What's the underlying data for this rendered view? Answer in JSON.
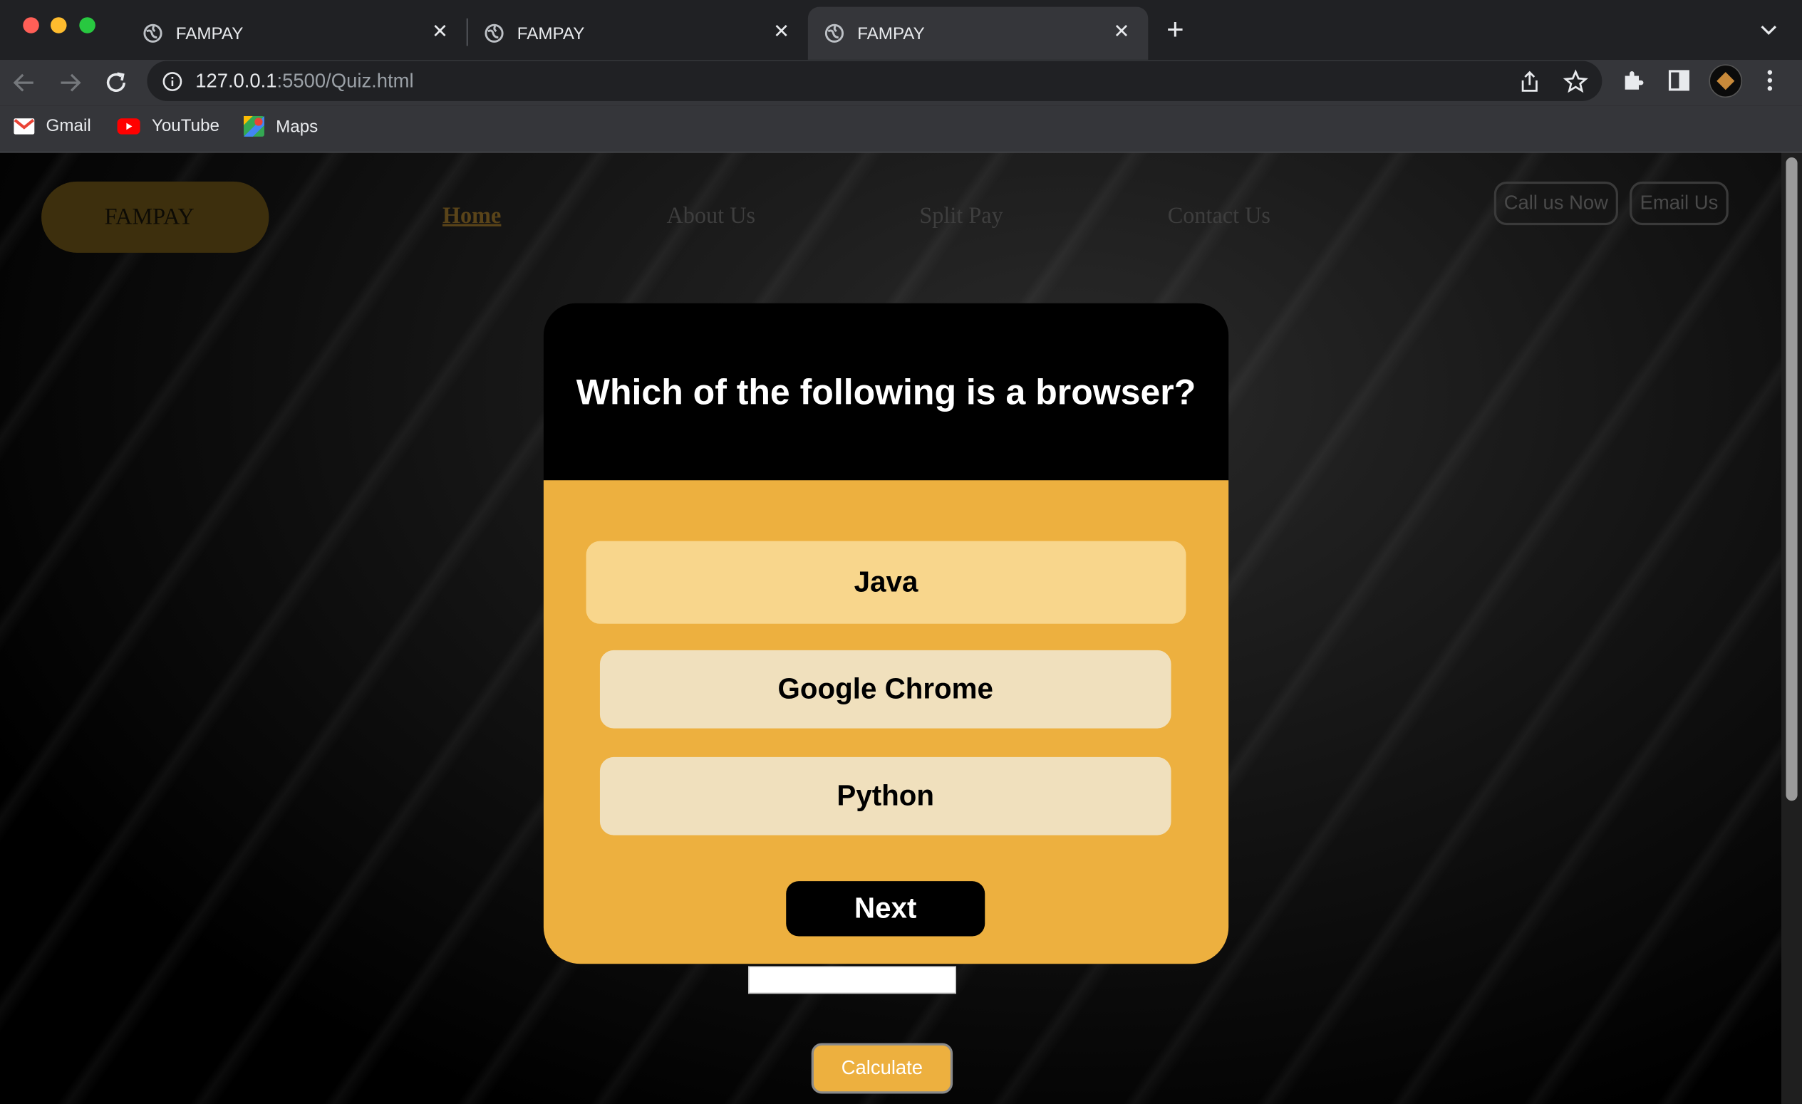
{
  "browser": {
    "tabs": [
      {
        "title": "FAMPAY",
        "active": false
      },
      {
        "title": "FAMPAY",
        "active": false
      },
      {
        "title": "FAMPAY",
        "active": true
      }
    ],
    "url_host": "127.0.0.1",
    "url_rest": ":5500/Quiz.html",
    "bookmarks": [
      "Gmail",
      "YouTube",
      "Maps"
    ]
  },
  "site": {
    "logo": "FAMPAY",
    "nav": [
      "Home",
      "About Us",
      "Split Pay",
      "Contact Us"
    ],
    "call_button": "Call us Now",
    "email_button": "Email Us"
  },
  "quiz": {
    "question": "Which of the following is a browser?",
    "options": [
      "Java",
      "Google Chrome",
      "Python"
    ],
    "next_label": "Next"
  },
  "calculator": {
    "input_value": "",
    "button_label": "Calculate"
  },
  "colors": {
    "accent": "#edb03f",
    "option_hover": "#f8d68c",
    "option": "#f0e0bd"
  }
}
